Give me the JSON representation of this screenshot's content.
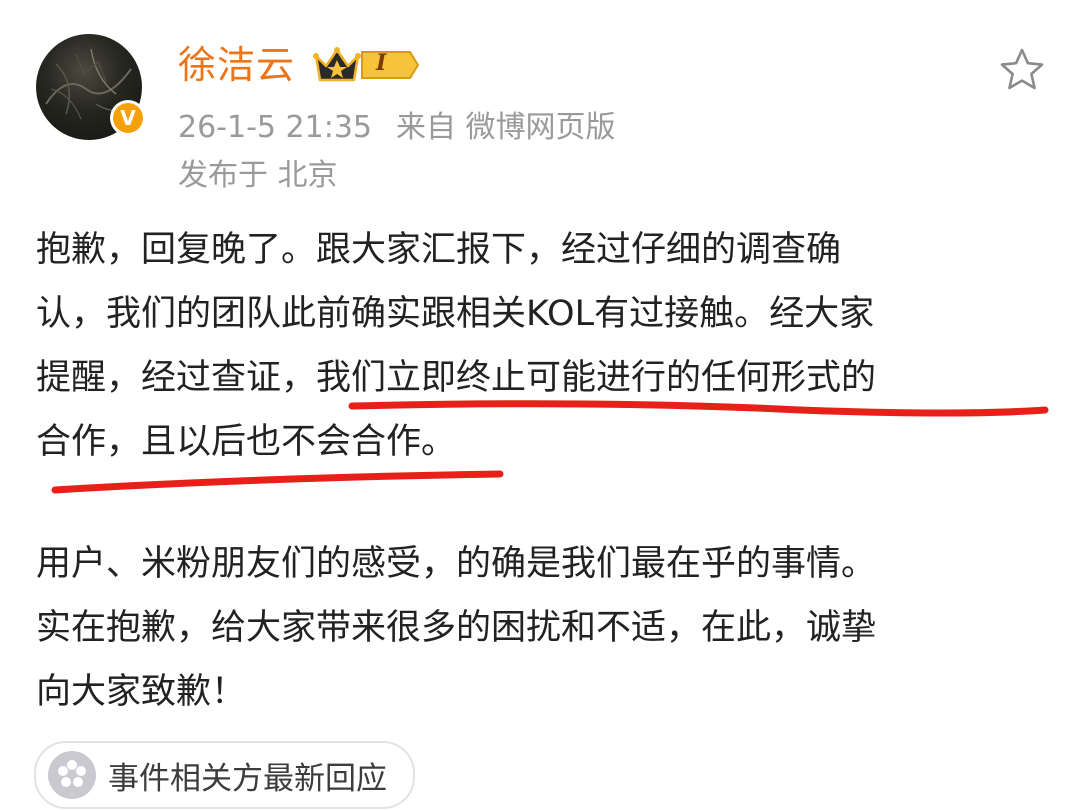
{
  "post": {
    "author": {
      "name": "徐洁云",
      "badge_level": "I",
      "verified_mark": "V"
    },
    "meta": {
      "time": "26-1-5 21:35",
      "source": "来自 微博网页版",
      "location": "发布于 北京"
    },
    "body": {
      "paragraph1": [
        "抱歉，回复晚了。跟大家汇报下，经过仔细的调查确",
        "认，我们的团队此前确实跟相关KOL有过接触。经大家",
        "提醒，经过查证，我们立即终止可能进行的任何形式的",
        "合作，且以后也不会合作。"
      ],
      "paragraph2": [
        "用户、米粉朋友们的感受，的确是我们最在乎的事情。",
        "实在抱歉，给大家带来很多的困扰和不适，在此，诚挚",
        "向大家致歉！"
      ]
    },
    "event_tag": {
      "label": "事件相关方最新回应",
      "icon": "flower-icon"
    }
  },
  "icons": {
    "favorite": "star-outline-icon",
    "badge": "crown-icon",
    "verified": "verified-v-icon"
  },
  "colors": {
    "username": "#ec7419",
    "meta_text": "#9a9a9a",
    "body_text": "#222222",
    "underline": "#e8201a",
    "verified": "#f7a10a"
  }
}
